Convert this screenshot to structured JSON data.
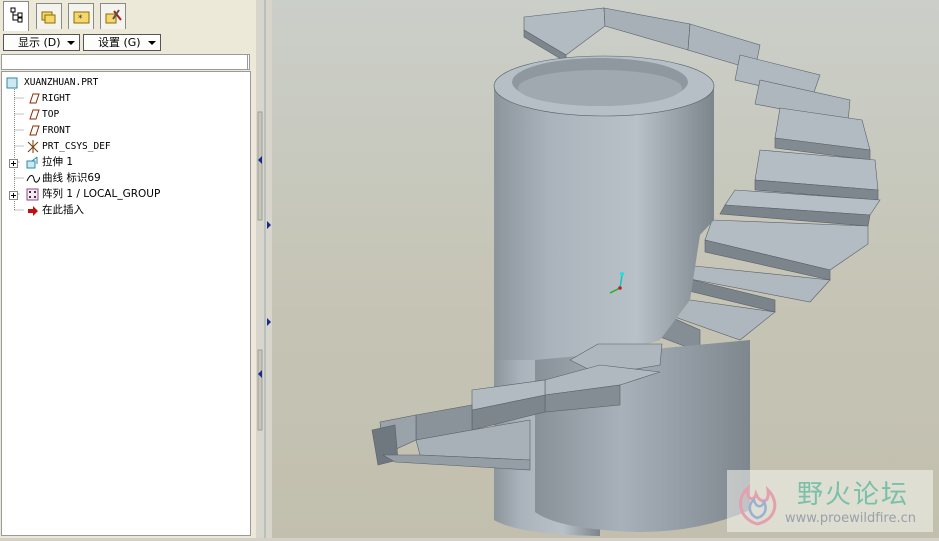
{
  "tabs": [
    {
      "name": "model-tree-tab",
      "icon": "model-tree-icon"
    },
    {
      "name": "folder-browser-tab",
      "icon": "folder-icon"
    },
    {
      "name": "favorites-tab",
      "icon": "favorites-folder-icon"
    },
    {
      "name": "connections-tab",
      "icon": "tools-icon"
    }
  ],
  "toolbar": {
    "show_label": "显示 (D)",
    "settings_label": "设置 (G)"
  },
  "tree": {
    "root": "XUANZHUAN.PRT",
    "items": [
      {
        "label": "RIGHT",
        "icon": "datum-plane-icon"
      },
      {
        "label": "TOP",
        "icon": "datum-plane-icon"
      },
      {
        "label": "FRONT",
        "icon": "datum-plane-icon"
      },
      {
        "label": "PRT_CSYS_DEF",
        "icon": "coordinate-system-icon"
      },
      {
        "label": "拉伸 1",
        "icon": "extrude-icon",
        "expandable": true
      },
      {
        "label": "曲线 标识69",
        "icon": "curve-icon"
      },
      {
        "label": "阵列 1 / LOCAL_GROUP",
        "icon": "pattern-icon",
        "expandable": true
      },
      {
        "label": "在此插入",
        "icon": "insert-here-arrow-icon"
      }
    ]
  },
  "watermark": {
    "title": "野火论坛",
    "url": "www.proewildfire.cn"
  },
  "colors": {
    "panel_bg": "#ece9d8",
    "model_face": "#a4adb5",
    "viewport_bg": "#c6c5b8"
  }
}
